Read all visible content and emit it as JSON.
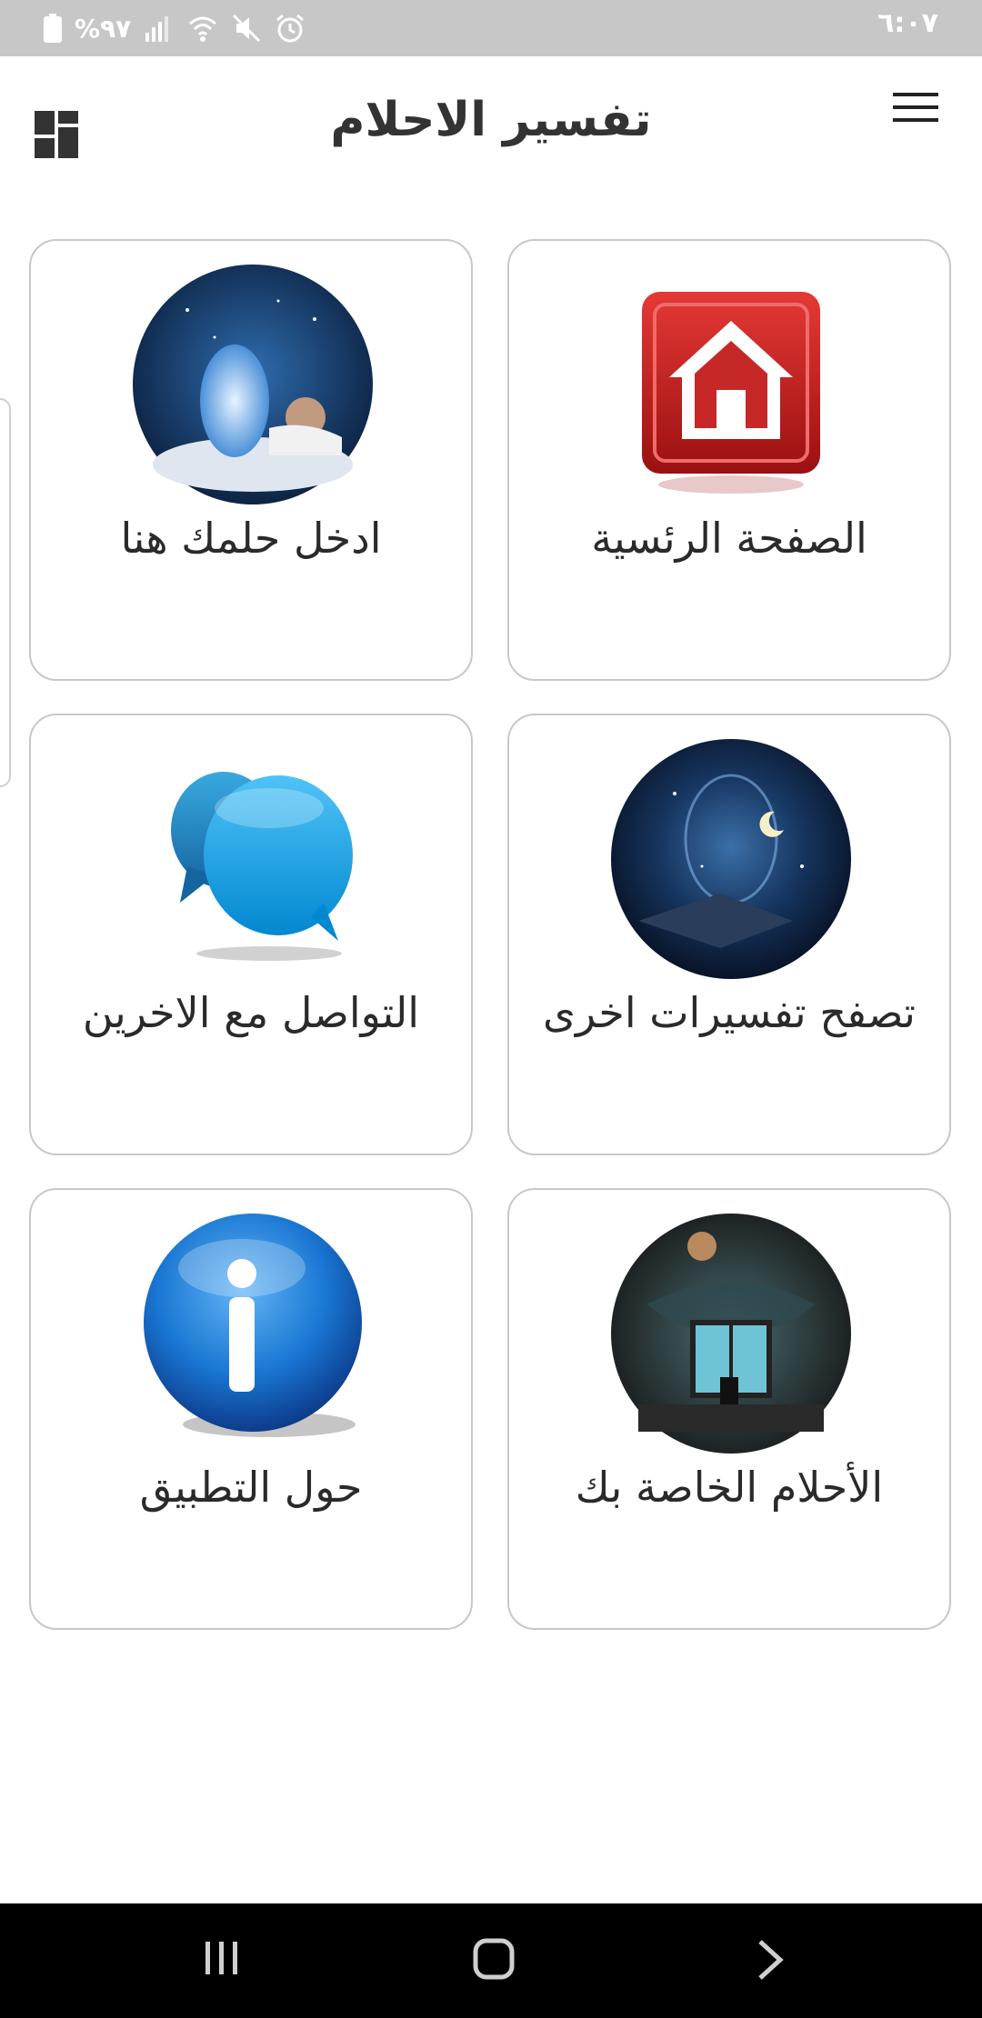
{
  "status_bar": {
    "time": "٦:٠٧",
    "battery_text": "%٩٧",
    "icons": [
      "battery-icon",
      "signal-icon",
      "wifi-icon",
      "mute-icon",
      "alarm-icon"
    ]
  },
  "header": {
    "title": "تفسير الاحلام",
    "left_icon": "dashboard-icon",
    "right_icon": "menu-icon"
  },
  "grid": {
    "items": [
      {
        "label": "الصفحة الرئسية",
        "icon": "home-icon"
      },
      {
        "label": "ادخل حلمك هنا",
        "icon": "dream-image"
      },
      {
        "label": "تصفح تفسيرات اخرى",
        "icon": "galaxy-image"
      },
      {
        "label": "التواصل مع الاخرين",
        "icon": "chat-icon"
      },
      {
        "label": "الأحلام الخاصة بك",
        "icon": "night-window-image"
      },
      {
        "label": "حول التطبيق",
        "icon": "info-icon"
      }
    ]
  },
  "nav_bar": {
    "icons": [
      "recents-icon",
      "home-nav-icon",
      "back-icon"
    ]
  },
  "colors": {
    "status_bar": "#c7c7c7",
    "home_red": "#c62828",
    "chat_blue": "#29a3d9",
    "info_blue": "#1565c0",
    "card_border": "#c8c8c8",
    "nav_bar": "#000000"
  }
}
